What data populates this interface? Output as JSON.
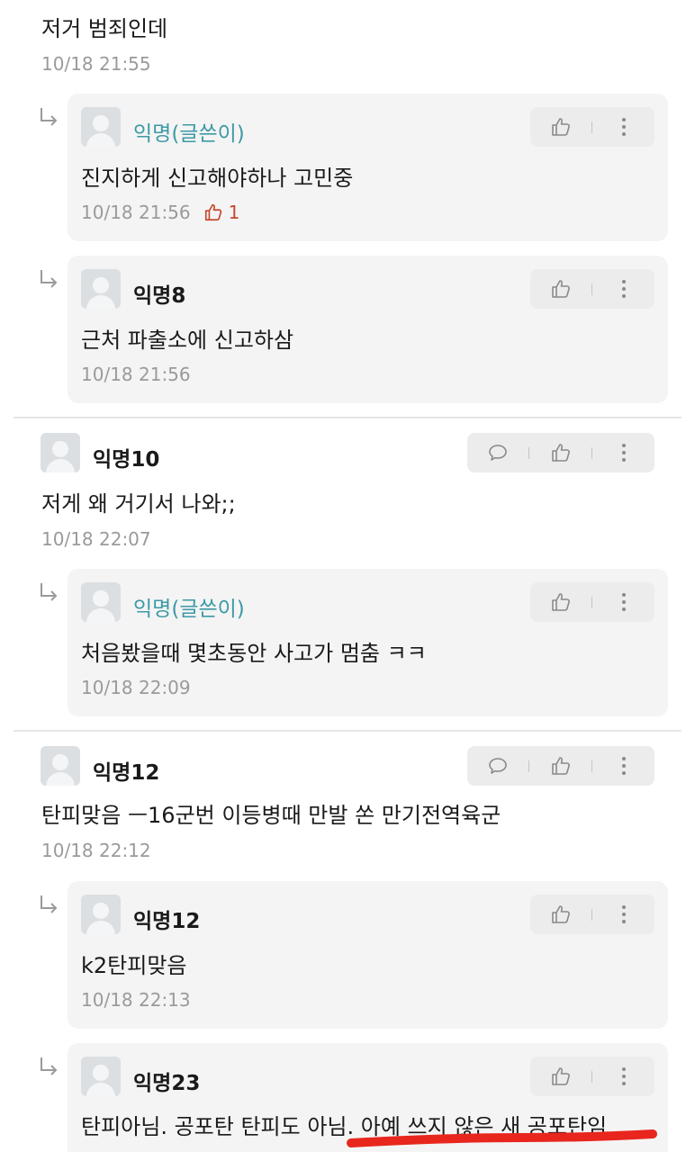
{
  "top_comment": {
    "text": "저거 범죄인데",
    "time": "10/18 21:55"
  },
  "reply1": {
    "author": "익명(글쓴이)",
    "text": "진지하게 신고해야하나 고민중",
    "time": "10/18 21:56",
    "likes": "1"
  },
  "reply2": {
    "author": "익명8",
    "text": "근처 파출소에 신고하삼",
    "time": "10/18 21:56"
  },
  "comment10": {
    "author": "익명10",
    "text": "저게 왜 거기서 나와;;",
    "time": "10/18 22:07"
  },
  "reply3": {
    "author": "익명(글쓴이)",
    "text": "처음봤을때 몇초동안 사고가 멈춤 ㅋㅋ",
    "time": "10/18 22:09"
  },
  "comment12": {
    "author": "익명12",
    "text": "탄피맞음 ㅡ16군번 이등병때 만발 쏜 만기전역육군",
    "time": "10/18 22:12"
  },
  "reply4": {
    "author": "익명12",
    "text": "k2탄피맞음",
    "time": "10/18 22:13"
  },
  "reply5": {
    "author": "익명23",
    "text": "탄피아님. 공포탄 탄피도 아님. 아예 쓰지 않은 새 공포탄임"
  },
  "colors": {
    "op_name": "#3c9aa6",
    "like_active": "#c6462f",
    "highlight": "#e8261e"
  },
  "icons": {
    "reply_arrow": "reply-arrow-icon",
    "like": "thumbs-up-icon",
    "more": "more-vertical-icon",
    "comment": "speech-bubble-icon"
  }
}
